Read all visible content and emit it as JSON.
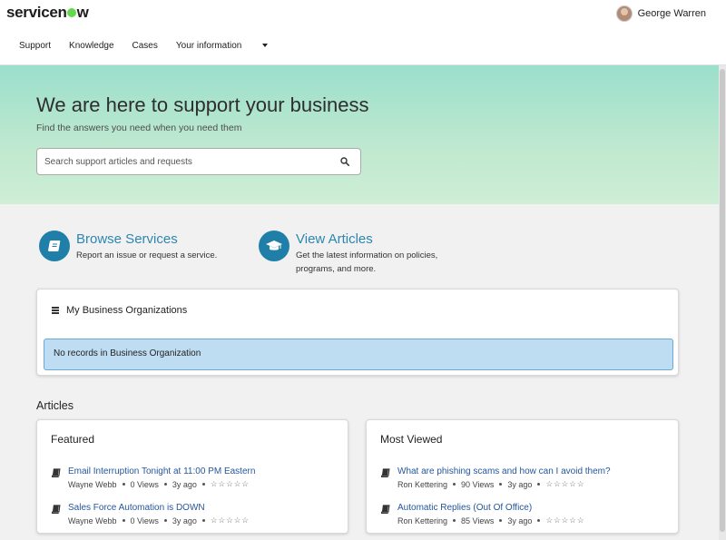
{
  "header": {
    "logo_left": "servicen",
    "logo_right": "w",
    "user_name": "George Warren",
    "nav": [
      "Support",
      "Knowledge",
      "Cases",
      "Your information"
    ]
  },
  "hero": {
    "title": "We are here to support your business",
    "subtitle": "Find the answers you need when you need them",
    "search_placeholder": "Search support articles and requests"
  },
  "services": [
    {
      "title": "Browse Services",
      "desc": "Report an issue or request a service.",
      "icon": "book-icon"
    },
    {
      "title": "View Articles",
      "desc": "Get the latest information on policies, programs, and more.",
      "icon": "graduation-cap-icon"
    }
  ],
  "orgs": {
    "title": "My Business Organizations",
    "empty": "No records in Business Organization"
  },
  "articles": {
    "section_title": "Articles",
    "featured": {
      "title": "Featured",
      "items": [
        {
          "title": "Email Interruption Tonight at 11:00 PM Eastern",
          "author": "Wayne Webb",
          "views": "0 Views",
          "age": "3y ago",
          "rating": "☆☆☆☆☆"
        },
        {
          "title": "Sales Force Automation is DOWN",
          "author": "Wayne Webb",
          "views": "0 Views",
          "age": "3y ago",
          "rating": "☆☆☆☆☆"
        }
      ]
    },
    "most_viewed": {
      "title": "Most Viewed",
      "items": [
        {
          "title": "What are phishing scams and how can I avoid them?",
          "author": "Ron Kettering",
          "views": "90 Views",
          "age": "3y ago",
          "rating": "☆☆☆☆☆"
        },
        {
          "title": "Automatic Replies (Out Of Office)",
          "author": "Ron Kettering",
          "views": "85 Views",
          "age": "3y ago",
          "rating": "☆☆☆☆☆"
        }
      ]
    }
  },
  "colors": {
    "accent": "#2d86b0",
    "icon_bg": "#1f7fa8",
    "link": "#25569b",
    "logo_green": "#62d84e"
  }
}
